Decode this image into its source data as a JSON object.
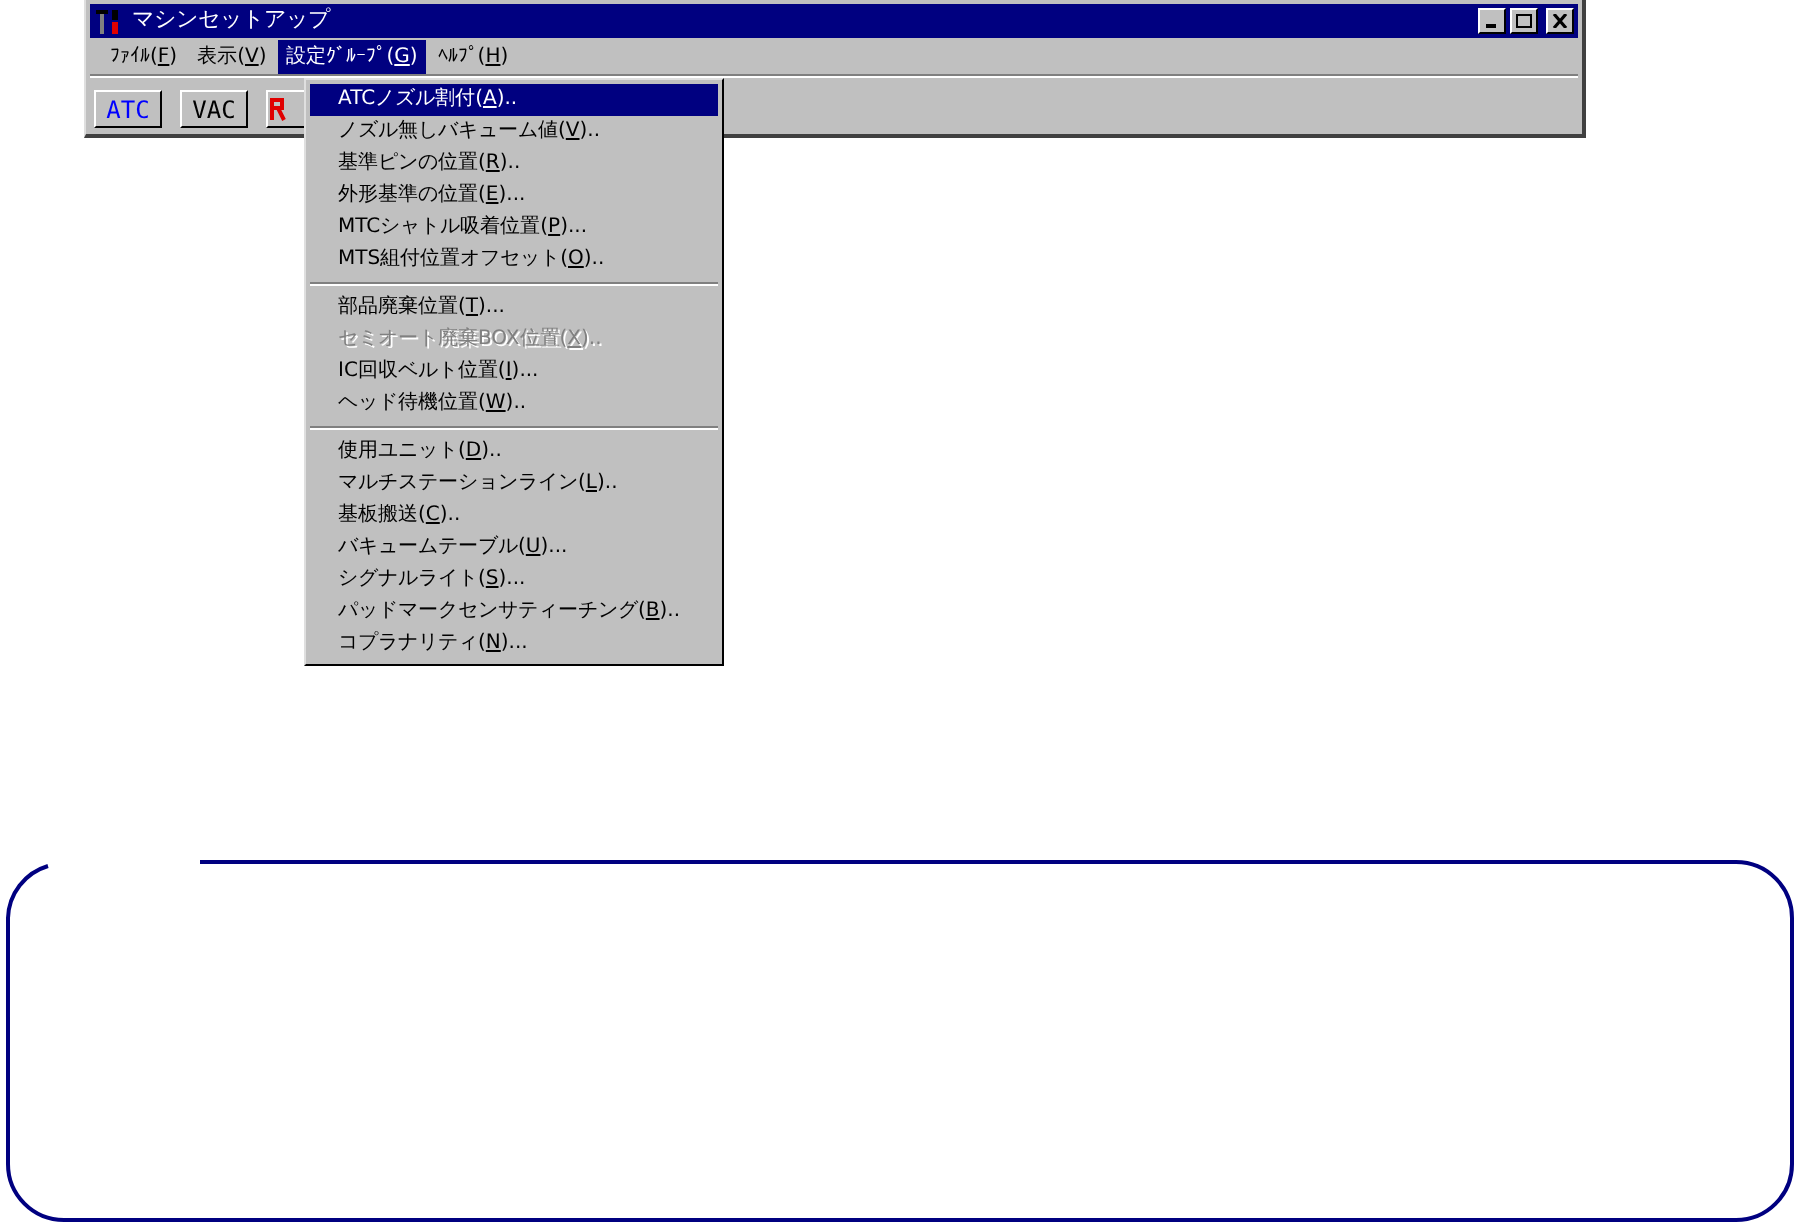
{
  "window": {
    "title": "マシンセットアップ"
  },
  "menu_bar": [
    {
      "prefix": "ﾌｧｲﾙ(",
      "key": "F",
      "suffix": ")",
      "selected": false
    },
    {
      "prefix": "表示(",
      "key": "V",
      "suffix": ")",
      "selected": false
    },
    {
      "prefix": "設定ｸﾞﾙｰﾌﾟ(",
      "key": "G",
      "suffix": ")",
      "selected": true
    },
    {
      "prefix": "ﾍﾙﾌﾟ(",
      "key": "H",
      "suffix": ")",
      "selected": false
    }
  ],
  "toolbar": [
    {
      "kind": "text",
      "label": "ATC"
    },
    {
      "kind": "text",
      "label": "VAC"
    },
    {
      "kind": "icon"
    }
  ],
  "dropdown": {
    "groups": [
      [
        {
          "prefix": "ATCノズル割付(",
          "key": "A",
          "suffix": ")..",
          "selected": true,
          "disabled": false
        },
        {
          "prefix": "ノズル無しバキューム値(",
          "key": "V",
          "suffix": ")..",
          "selected": false,
          "disabled": false
        },
        {
          "prefix": "基準ピンの位置(",
          "key": "R",
          "suffix": ")..",
          "selected": false,
          "disabled": false
        },
        {
          "prefix": "外形基準の位置(",
          "key": "E",
          "suffix": ")...",
          "selected": false,
          "disabled": false
        },
        {
          "prefix": "MTCシャトル吸着位置(",
          "key": "P",
          "suffix": ")...",
          "selected": false,
          "disabled": false
        },
        {
          "prefix": "MTS組付位置オフセット(",
          "key": "O",
          "suffix": ")..",
          "selected": false,
          "disabled": false
        }
      ],
      [
        {
          "prefix": "部品廃棄位置(",
          "key": "T",
          "suffix": ")...",
          "selected": false,
          "disabled": false
        },
        {
          "prefix": "セミオート廃棄BOX位置(",
          "key": "X",
          "suffix": ")..",
          "selected": false,
          "disabled": true
        },
        {
          "prefix": "IC回収ベルト位置(",
          "key": "I",
          "suffix": ")...",
          "selected": false,
          "disabled": false
        },
        {
          "prefix": "ヘッド待機位置(",
          "key": "W",
          "suffix": ")..",
          "selected": false,
          "disabled": false
        }
      ],
      [
        {
          "prefix": "使用ユニット(",
          "key": "D",
          "suffix": ")..",
          "selected": false,
          "disabled": false
        },
        {
          "prefix": "マルチステーションライン(",
          "key": "L",
          "suffix": ")..",
          "selected": false,
          "disabled": false
        },
        {
          "prefix": "基板搬送(",
          "key": "C",
          "suffix": ")..",
          "selected": false,
          "disabled": false
        },
        {
          "prefix": "バキュームテーブル(",
          "key": "U",
          "suffix": ")...",
          "selected": false,
          "disabled": false
        },
        {
          "prefix": "シグナルライト(",
          "key": "S",
          "suffix": ")...",
          "selected": false,
          "disabled": false
        },
        {
          "prefix": "パッドマークセンサティーチング(",
          "key": "B",
          "suffix": ")..",
          "selected": false,
          "disabled": false
        },
        {
          "prefix": "コプラナリティ(",
          "key": "N",
          "suffix": ")...",
          "selected": false,
          "disabled": false
        }
      ]
    ]
  }
}
